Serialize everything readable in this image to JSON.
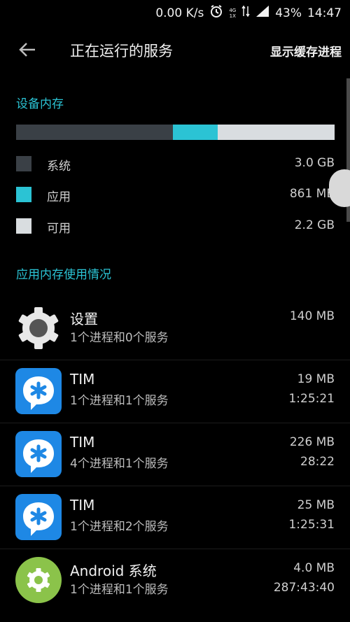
{
  "status_bar": {
    "speed": "0.00 K/s",
    "network_label_top": "4G",
    "network_label_bottom": "1X",
    "battery": "43%",
    "time": "14:47"
  },
  "app_bar": {
    "title": "正在运行的服务",
    "action_label": "显示缓存进程"
  },
  "device_memory": {
    "section_title": "设备内存",
    "usage_fractions": {
      "system": 0.4927,
      "app": 0.1413,
      "free": 0.366
    },
    "colors": {
      "system": "#3a4046",
      "app": "#2bc3d4",
      "free": "#d9dde0"
    },
    "legend": [
      {
        "label": "系统",
        "value": "3.0 GB"
      },
      {
        "label": "应用",
        "value": "861 MB"
      },
      {
        "label": "可用",
        "value": "2.2 GB"
      }
    ]
  },
  "app_memory": {
    "section_title": "应用内存使用情况",
    "apps": [
      {
        "name": "设置",
        "subtitle": "1个进程和0个服务",
        "memory": "140 MB",
        "time": "",
        "icon": "settings-gear-icon"
      },
      {
        "name": "TIM",
        "subtitle": "1个进程和1个服务",
        "memory": "19 MB",
        "time": "1:25:21",
        "icon": "tim-app-icon"
      },
      {
        "name": "TIM",
        "subtitle": "4个进程和1个服务",
        "memory": "226 MB",
        "time": "28:22",
        "icon": "tim-app-icon"
      },
      {
        "name": "TIM",
        "subtitle": "1个进程和2个服务",
        "memory": "25 MB",
        "time": "1:25:31",
        "icon": "tim-app-icon"
      },
      {
        "name": "Android 系统",
        "subtitle": "1个进程和1个服务",
        "memory": "4.0 MB",
        "time": "287:43:40",
        "icon": "android-system-icon"
      }
    ]
  }
}
